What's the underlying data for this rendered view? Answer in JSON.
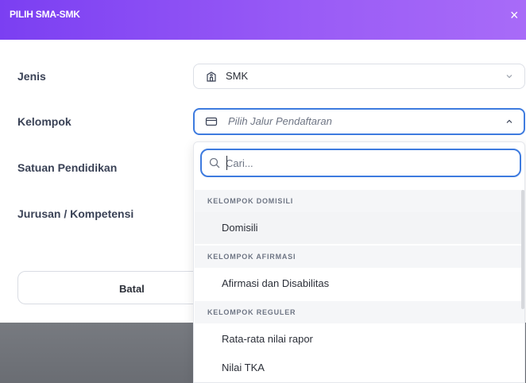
{
  "modal": {
    "title": "PILIH SMA-SMK",
    "close_label": "×"
  },
  "fields": {
    "jenis": {
      "label": "Jenis",
      "value": "SMK",
      "icon": "school-icon"
    },
    "kelompok": {
      "label": "Kelompok",
      "placeholder": "Pilih Jalur Pendaftaran",
      "icon": "card-icon"
    },
    "satuan": {
      "label": "Satuan Pendidikan"
    },
    "jurusan": {
      "label": "Jurusan / Kompetensi"
    }
  },
  "buttons": {
    "cancel": "Batal"
  },
  "dropdown": {
    "search_placeholder": "Cari...",
    "groups": [
      {
        "header": "KELOMPOK DOMISILI",
        "options": [
          "Domisili"
        ]
      },
      {
        "header": "KELOMPOK AFIRMASI",
        "options": [
          "Afirmasi dan Disabilitas"
        ]
      },
      {
        "header": "KELOMPOK REGULER",
        "options": [
          "Rata-rata nilai rapor",
          "Nilai TKA"
        ]
      }
    ]
  },
  "colors": {
    "header_start": "#7b3ff2",
    "header_end": "#a86bf8",
    "focus_border": "#3e7bdf",
    "label_text": "#3a4256"
  }
}
